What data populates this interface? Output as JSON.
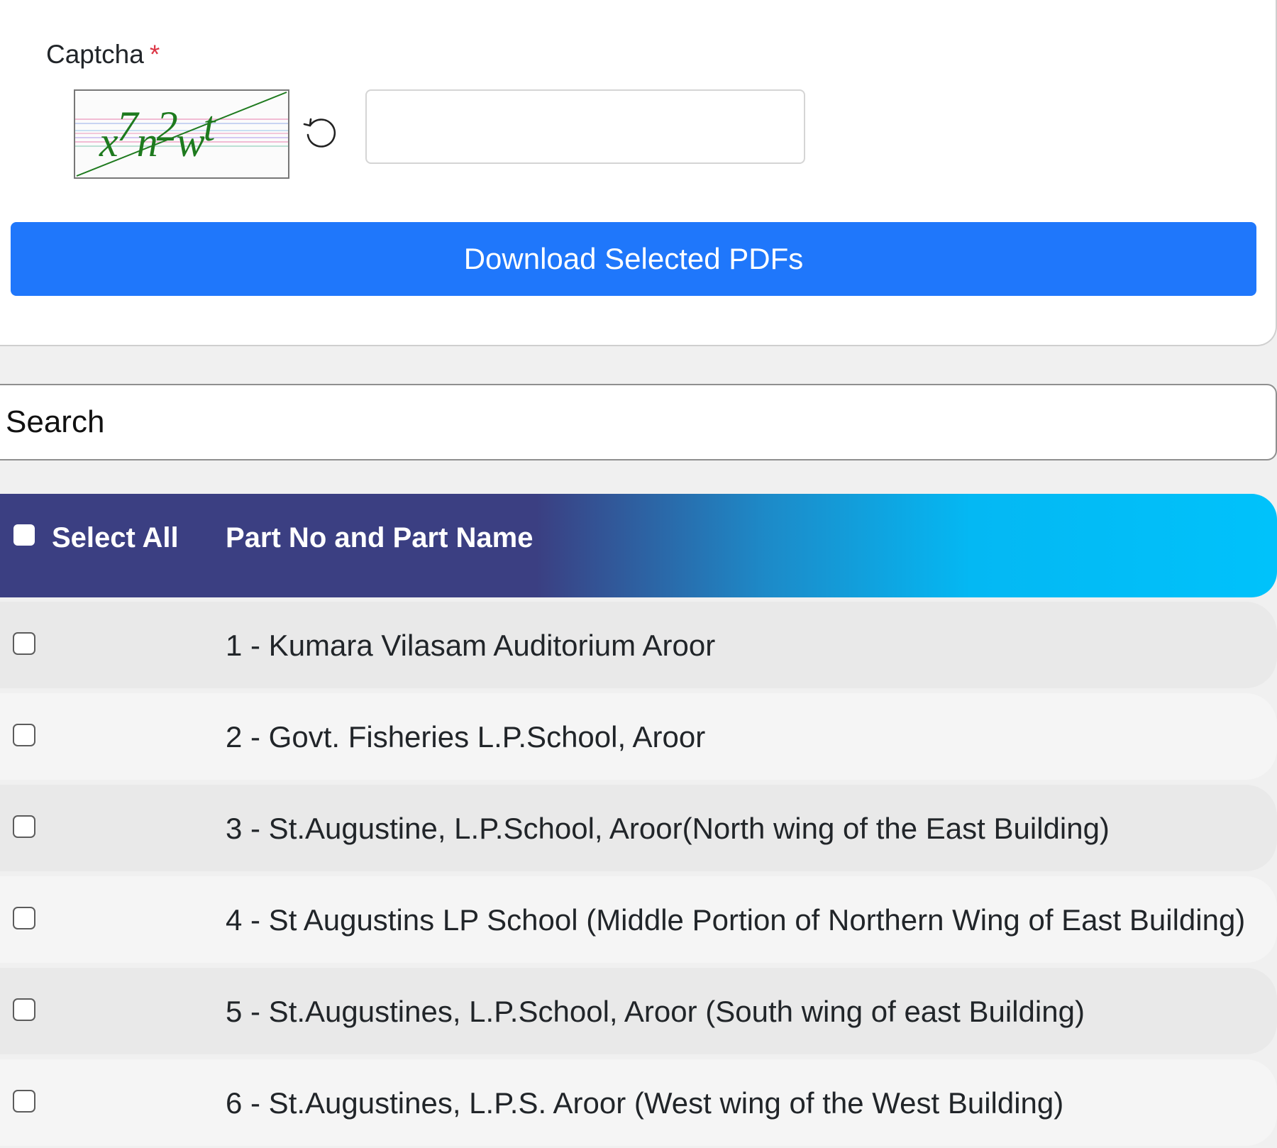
{
  "captcha": {
    "label": "Captcha",
    "required_mark": "*",
    "image_text": "x7n2wt",
    "input_value": "",
    "refresh_icon": "refresh-icon"
  },
  "actions": {
    "download_label": "Download Selected PDFs"
  },
  "search": {
    "placeholder": "Search",
    "value": ""
  },
  "table": {
    "header": {
      "select_all_label": "Select All",
      "column_label": "Part No and Part Name"
    },
    "rows": [
      {
        "checked": false,
        "label": "1 - Kumara Vilasam Auditorium Aroor"
      },
      {
        "checked": false,
        "label": "2 - Govt. Fisheries L.P.School, Aroor"
      },
      {
        "checked": false,
        "label": "3 - St.Augustine, L.P.School, Aroor(North wing of the East Building)"
      },
      {
        "checked": false,
        "label": "4 - St Augustins LP School (Middle Portion of Northern Wing of East Building)"
      },
      {
        "checked": false,
        "label": "5 - St.Augustines, L.P.School, Aroor (South wing of east Building)"
      },
      {
        "checked": false,
        "label": "6 - St.Augustines, L.P.S. Aroor (West wing of the West Building)"
      }
    ]
  },
  "colors": {
    "primary_button": "#1f77fb",
    "header_gradient_start": "#3b3f82",
    "header_gradient_end": "#00c2fb",
    "required": "#dc3545",
    "captcha_text": "#1e7a1e"
  }
}
